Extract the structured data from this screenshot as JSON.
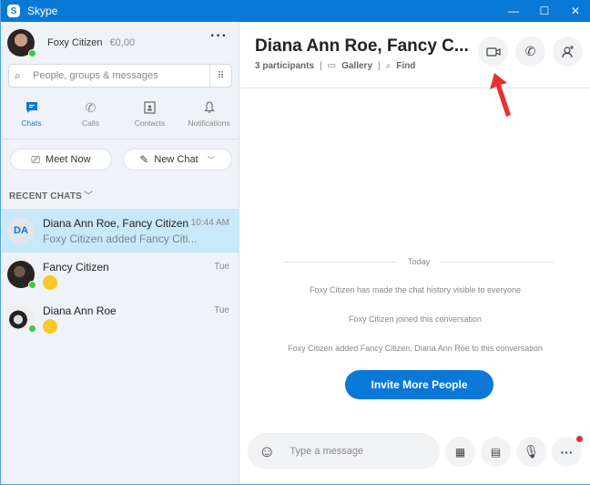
{
  "window": {
    "title": "Skype",
    "logo": "S",
    "controls": {
      "minimize": "—",
      "maximize": "☐",
      "close": "✕"
    }
  },
  "profile": {
    "name": "Foxy Citizen",
    "balance": "€0,00",
    "status": "online"
  },
  "search": {
    "placeholder": "People, groups & messages"
  },
  "nav": [
    {
      "label": "Chats",
      "icon": "chat-icon",
      "active": true
    },
    {
      "label": "Calls",
      "icon": "phone-icon"
    },
    {
      "label": "Contacts",
      "icon": "contacts-icon"
    },
    {
      "label": "Notifications",
      "icon": "bell-icon"
    }
  ],
  "actions": {
    "meet_now": "Meet Now",
    "new_chat": "New Chat"
  },
  "recent_label": "RECENT CHATS",
  "chats": [
    {
      "initials": "DA",
      "name": "Diana Ann Roe, Fancy Citizen",
      "preview": "Foxy Citizen added Fancy Citi...",
      "time": "10:44 AM",
      "selected": true
    },
    {
      "name": "Fancy Citizen",
      "preview": "emoji",
      "time": "Tue",
      "status": "online"
    },
    {
      "name": "Diana Ann Roe",
      "preview": "emoji",
      "time": "Tue",
      "status": "online"
    }
  ],
  "conversation": {
    "title": "Diana Ann Roe, Fancy C...",
    "participants": "3 participants",
    "gallery": "Gallery",
    "find": "Find",
    "date_divider": "Today",
    "system_messages": [
      "Foxy Citizen has made the chat history visible to everyone",
      "Foxy Citizen joined this conversation",
      "Foxy Citizen added Fancy Citizen, Diana Ann Roe to this conversation"
    ],
    "invite_label": "Invite More People",
    "compose_placeholder": "Type a message"
  },
  "colors": {
    "accent": "#0a78d7",
    "selected": "#c7e9fa",
    "online": "#3cc84a",
    "annotation_arrow": "#e8312f"
  }
}
